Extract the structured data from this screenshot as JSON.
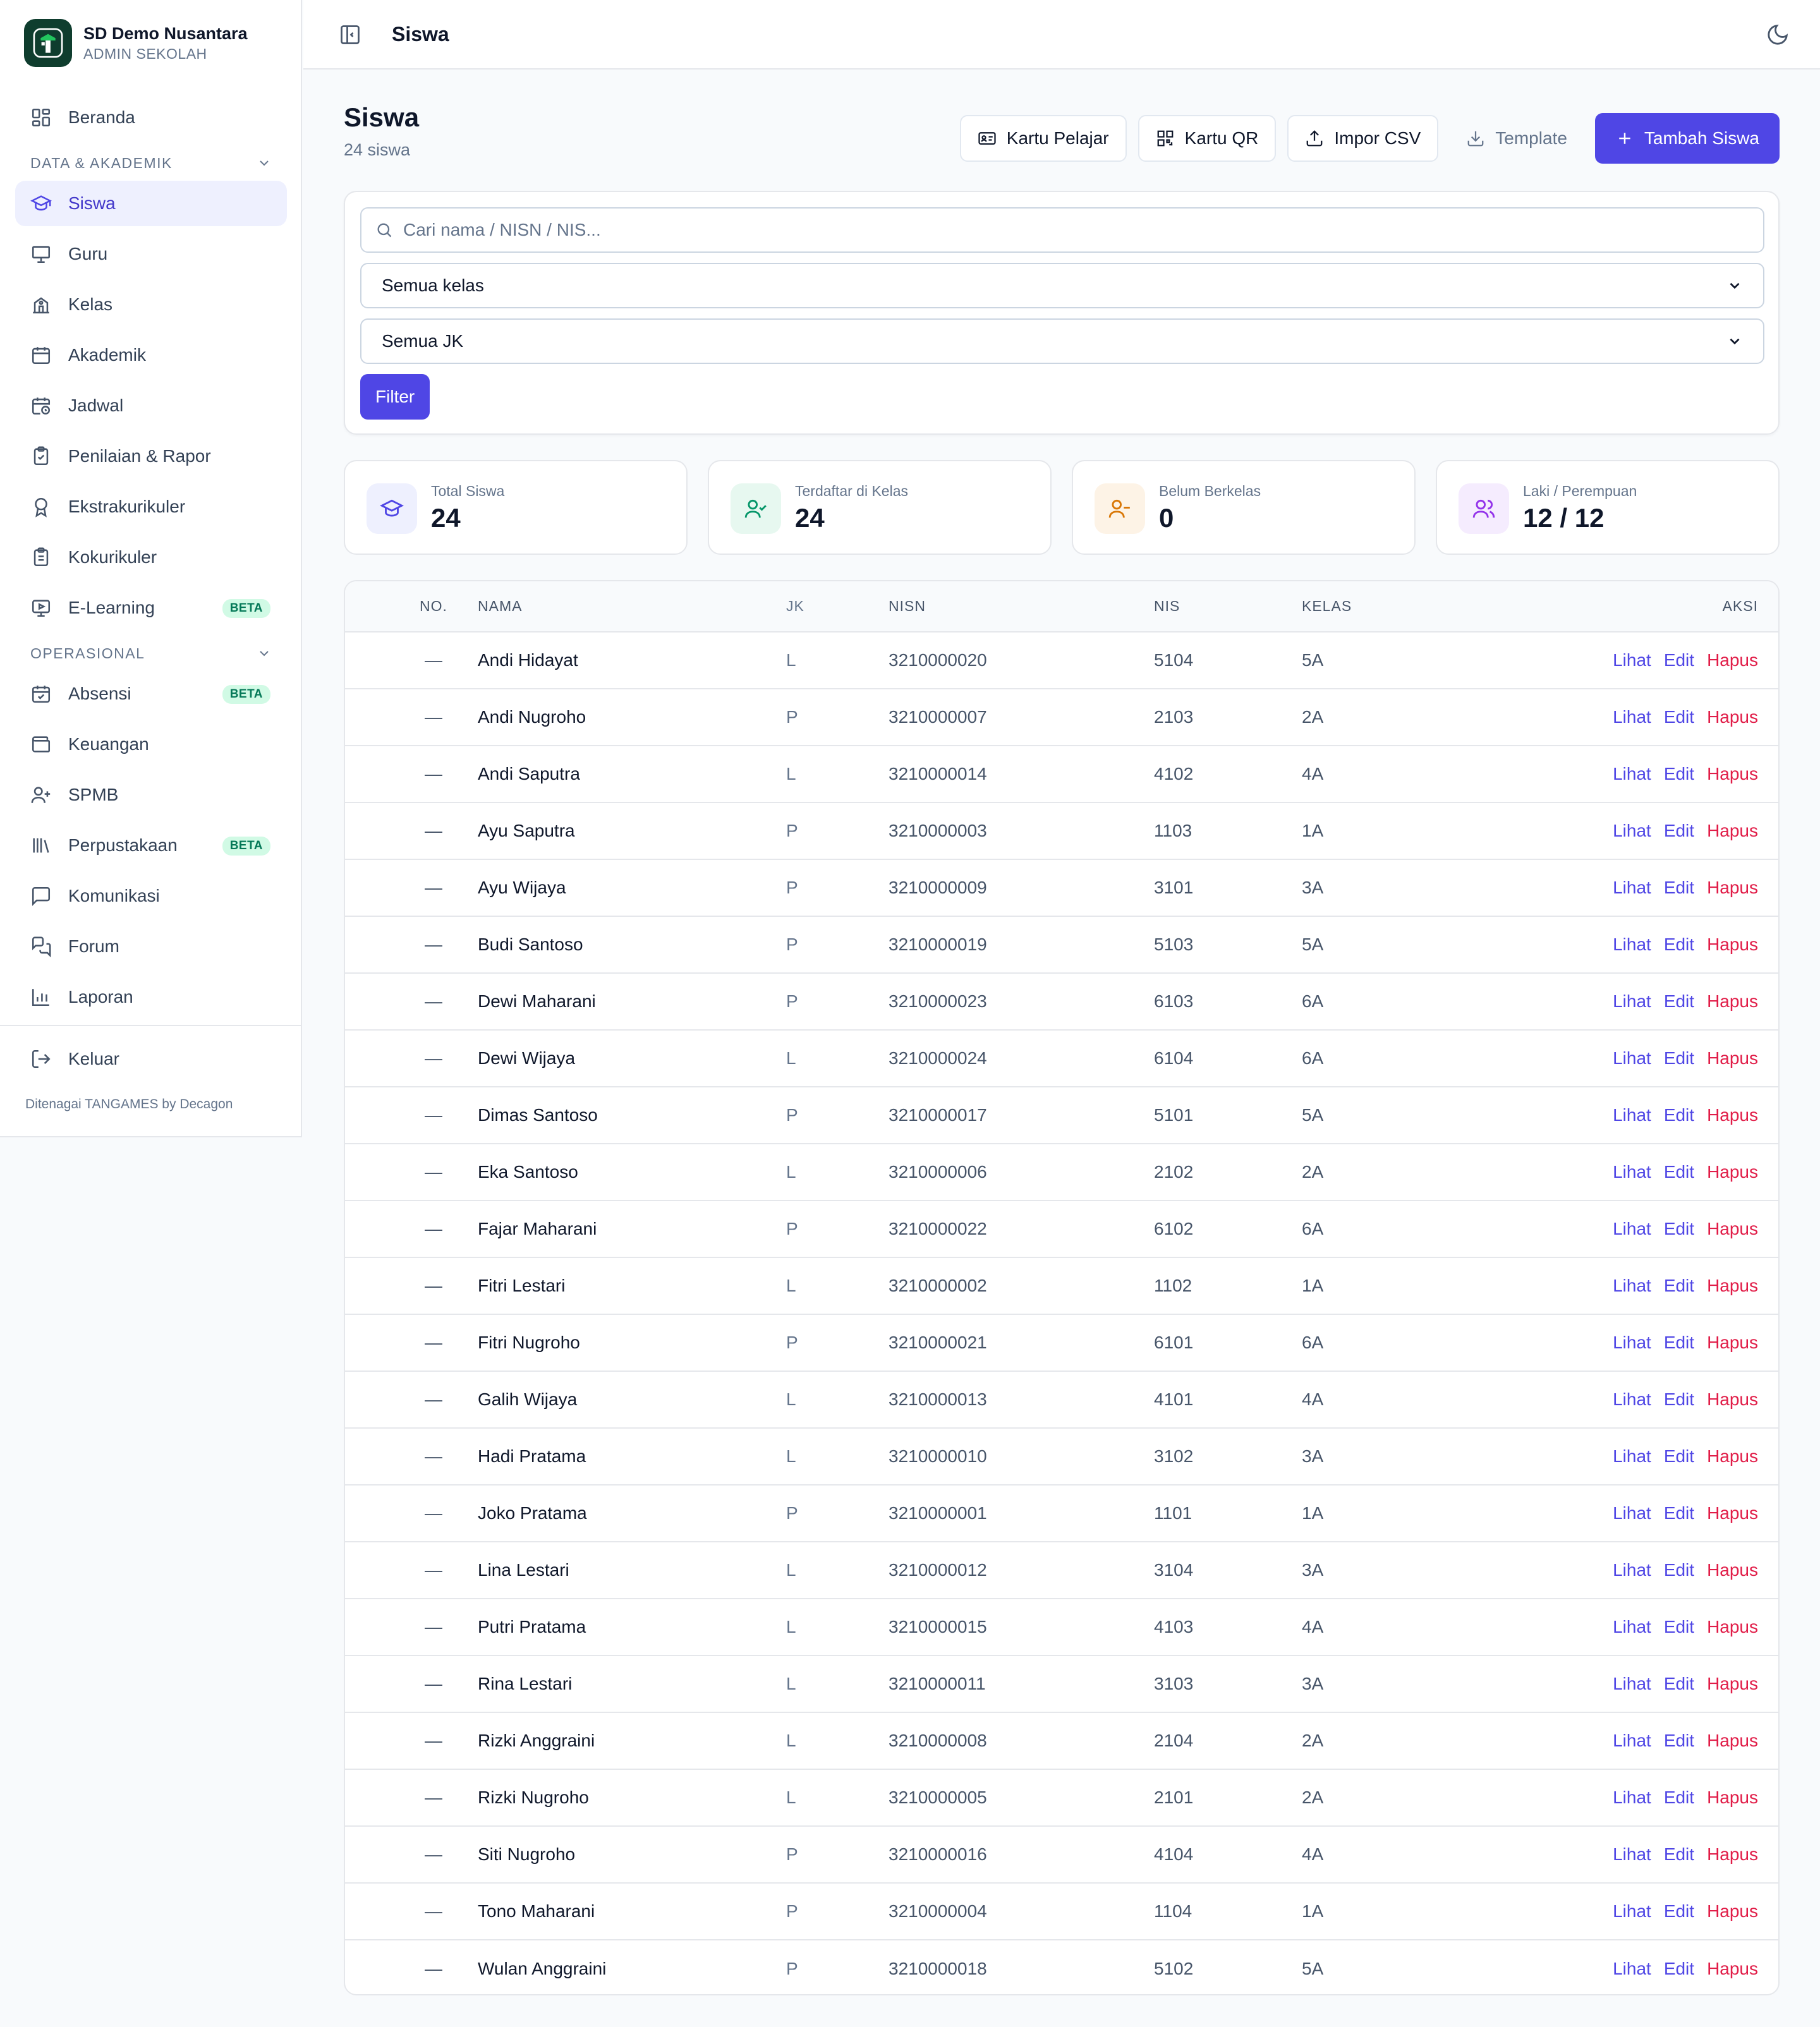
{
  "brand": {
    "name": "SD Demo Nusantara",
    "role": "ADMIN SEKOLAH"
  },
  "sidebar": {
    "top": [
      {
        "label": "Beranda",
        "icon": "dashboard-icon"
      }
    ],
    "section_data": {
      "title": "DATA & AKADEMIK"
    },
    "data_items": [
      {
        "label": "Siswa",
        "icon": "graduation-cap-icon",
        "active": true
      },
      {
        "label": "Guru",
        "icon": "presentation-icon"
      },
      {
        "label": "Kelas",
        "icon": "school-icon"
      },
      {
        "label": "Akademik",
        "icon": "calendar-icon"
      },
      {
        "label": "Jadwal",
        "icon": "calendar-clock-icon"
      },
      {
        "label": "Penilaian & Rapor",
        "icon": "clipboard-check-icon"
      },
      {
        "label": "Ekstrakurikuler",
        "icon": "award-icon"
      },
      {
        "label": "Kokurikuler",
        "icon": "clipboard-list-icon"
      },
      {
        "label": "E-Learning",
        "icon": "monitor-play-icon",
        "badge": "BETA"
      }
    ],
    "section_ops": {
      "title": "OPERASIONAL"
    },
    "ops_items": [
      {
        "label": "Absensi",
        "icon": "calendar-check-icon",
        "badge": "BETA"
      },
      {
        "label": "Keuangan",
        "icon": "wallet-icon"
      },
      {
        "label": "SPMB",
        "icon": "user-plus-icon"
      },
      {
        "label": "Perpustakaan",
        "icon": "library-icon",
        "badge": "BETA"
      },
      {
        "label": "Komunikasi",
        "icon": "message-square-icon"
      },
      {
        "label": "Forum",
        "icon": "messages-icon"
      },
      {
        "label": "Laporan",
        "icon": "bar-chart-icon"
      }
    ],
    "logout": "Keluar",
    "powered": "Ditenagai TANGAMES by Decagon"
  },
  "topbar": {
    "title": "Siswa"
  },
  "page": {
    "title": "Siswa",
    "subtitle": "24 siswa"
  },
  "actions": {
    "kartu_pelajar": "Kartu Pelajar",
    "kartu_qr": "Kartu QR",
    "impor_csv": "Impor CSV",
    "template": "Template",
    "tambah": "Tambah Siswa"
  },
  "filters": {
    "search_placeholder": "Cari nama / NISN / NIS...",
    "kelas": "Semua kelas",
    "jk": "Semua JK",
    "button": "Filter"
  },
  "stats": [
    {
      "label": "Total Siswa",
      "value": "24",
      "color": "#4f46e5",
      "bg": "#eef0fe"
    },
    {
      "label": "Terdaftar di Kelas",
      "value": "24",
      "color": "#059669",
      "bg": "#e7f8f0"
    },
    {
      "label": "Belum Berkelas",
      "value": "0",
      "color": "#d97706",
      "bg": "#fdf3e6"
    },
    {
      "label": "Laki / Perempuan",
      "value": "12 / 12",
      "color": "#9333ea",
      "bg": "#f5ecfe"
    }
  ],
  "table": {
    "headers": {
      "no": "NO.",
      "nama": "NAMA",
      "jk": "JK",
      "nisn": "NISN",
      "nis": "NIS",
      "kelas": "KELAS",
      "aksi": "AKSI"
    },
    "actions": {
      "view": "Lihat",
      "edit": "Edit",
      "delete": "Hapus"
    },
    "rows": [
      {
        "no": "—",
        "nama": "Andi Hidayat",
        "jk": "L",
        "nisn": "3210000020",
        "nis": "5104",
        "kelas": "5A"
      },
      {
        "no": "—",
        "nama": "Andi Nugroho",
        "jk": "P",
        "nisn": "3210000007",
        "nis": "2103",
        "kelas": "2A"
      },
      {
        "no": "—",
        "nama": "Andi Saputra",
        "jk": "L",
        "nisn": "3210000014",
        "nis": "4102",
        "kelas": "4A"
      },
      {
        "no": "—",
        "nama": "Ayu Saputra",
        "jk": "P",
        "nisn": "3210000003",
        "nis": "1103",
        "kelas": "1A"
      },
      {
        "no": "—",
        "nama": "Ayu Wijaya",
        "jk": "P",
        "nisn": "3210000009",
        "nis": "3101",
        "kelas": "3A"
      },
      {
        "no": "—",
        "nama": "Budi Santoso",
        "jk": "P",
        "nisn": "3210000019",
        "nis": "5103",
        "kelas": "5A"
      },
      {
        "no": "—",
        "nama": "Dewi Maharani",
        "jk": "P",
        "nisn": "3210000023",
        "nis": "6103",
        "kelas": "6A"
      },
      {
        "no": "—",
        "nama": "Dewi Wijaya",
        "jk": "L",
        "nisn": "3210000024",
        "nis": "6104",
        "kelas": "6A"
      },
      {
        "no": "—",
        "nama": "Dimas Santoso",
        "jk": "P",
        "nisn": "3210000017",
        "nis": "5101",
        "kelas": "5A"
      },
      {
        "no": "—",
        "nama": "Eka Santoso",
        "jk": "L",
        "nisn": "3210000006",
        "nis": "2102",
        "kelas": "2A"
      },
      {
        "no": "—",
        "nama": "Fajar Maharani",
        "jk": "P",
        "nisn": "3210000022",
        "nis": "6102",
        "kelas": "6A"
      },
      {
        "no": "—",
        "nama": "Fitri Lestari",
        "jk": "L",
        "nisn": "3210000002",
        "nis": "1102",
        "kelas": "1A"
      },
      {
        "no": "—",
        "nama": "Fitri Nugroho",
        "jk": "P",
        "nisn": "3210000021",
        "nis": "6101",
        "kelas": "6A"
      },
      {
        "no": "—",
        "nama": "Galih Wijaya",
        "jk": "L",
        "nisn": "3210000013",
        "nis": "4101",
        "kelas": "4A"
      },
      {
        "no": "—",
        "nama": "Hadi Pratama",
        "jk": "L",
        "nisn": "3210000010",
        "nis": "3102",
        "kelas": "3A"
      },
      {
        "no": "—",
        "nama": "Joko Pratama",
        "jk": "P",
        "nisn": "3210000001",
        "nis": "1101",
        "kelas": "1A"
      },
      {
        "no": "—",
        "nama": "Lina Lestari",
        "jk": "L",
        "nisn": "3210000012",
        "nis": "3104",
        "kelas": "3A"
      },
      {
        "no": "—",
        "nama": "Putri Pratama",
        "jk": "L",
        "nisn": "3210000015",
        "nis": "4103",
        "kelas": "4A"
      },
      {
        "no": "—",
        "nama": "Rina Lestari",
        "jk": "L",
        "nisn": "3210000011",
        "nis": "3103",
        "kelas": "3A"
      },
      {
        "no": "—",
        "nama": "Rizki Anggraini",
        "jk": "L",
        "nisn": "3210000008",
        "nis": "2104",
        "kelas": "2A"
      },
      {
        "no": "—",
        "nama": "Rizki Nugroho",
        "jk": "L",
        "nisn": "3210000005",
        "nis": "2101",
        "kelas": "2A"
      },
      {
        "no": "—",
        "nama": "Siti Nugroho",
        "jk": "P",
        "nisn": "3210000016",
        "nis": "4104",
        "kelas": "4A"
      },
      {
        "no": "—",
        "nama": "Tono Maharani",
        "jk": "P",
        "nisn": "3210000004",
        "nis": "1104",
        "kelas": "1A"
      },
      {
        "no": "—",
        "nama": "Wulan Anggraini",
        "jk": "P",
        "nisn": "3210000018",
        "nis": "5102",
        "kelas": "5A"
      }
    ]
  }
}
